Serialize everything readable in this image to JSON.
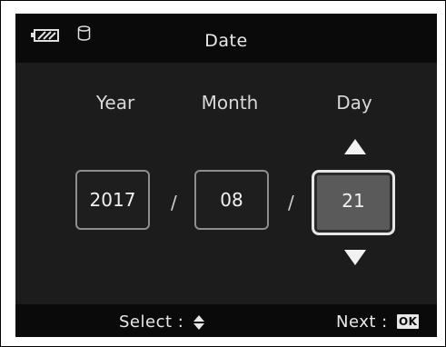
{
  "header": {
    "title": "Date",
    "icons": [
      "battery-icon",
      "memory-card-icon"
    ]
  },
  "fields": {
    "year_label": "Year",
    "month_label": "Month",
    "day_label": "Day"
  },
  "values": {
    "year": "2017",
    "month": "08",
    "day": "21",
    "separator": "/"
  },
  "selected_field": "day",
  "footer": {
    "select_label": "Select :",
    "next_label": "Next :",
    "ok_label": "OK"
  }
}
